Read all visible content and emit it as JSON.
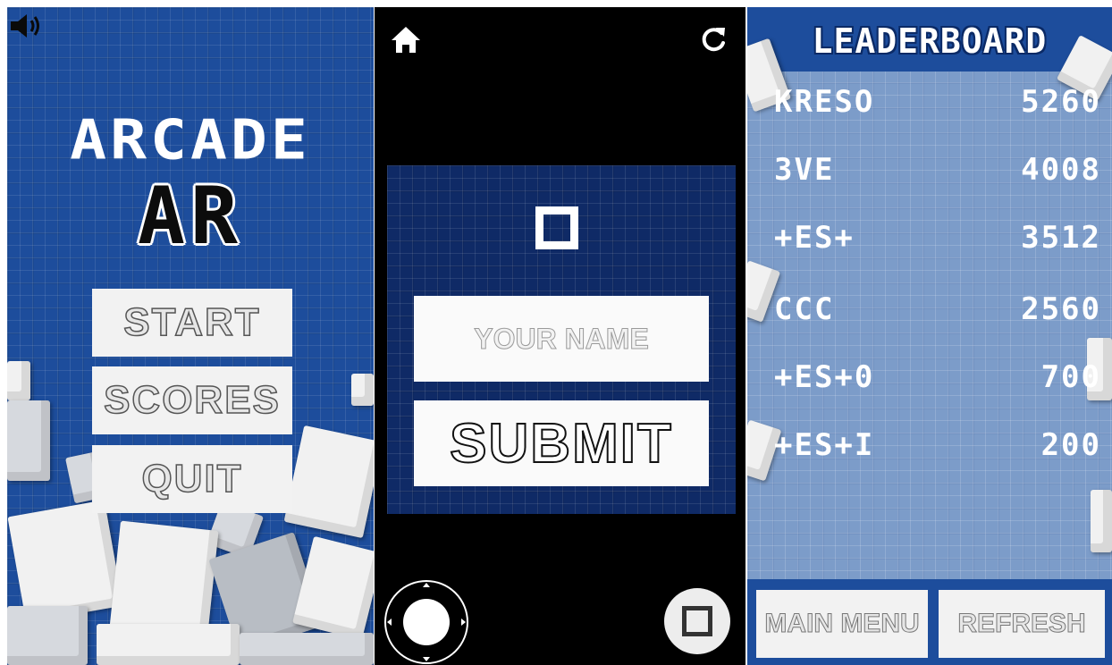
{
  "menu_screen": {
    "title_line1": "ARCADE",
    "title_line2": "AR",
    "buttons": [
      {
        "label": "START"
      },
      {
        "label": "SCORES"
      },
      {
        "label": "QUIT"
      }
    ],
    "sound_icon": "speaker-icon"
  },
  "submit_screen": {
    "home_icon": "home-icon",
    "refresh_icon": "refresh-icon",
    "name_placeholder": "YOUR NAME",
    "name_value": "",
    "submit_label": "SUBMIT",
    "joystick_icon": "joystick-icon",
    "action_icon": "square-action-icon"
  },
  "leaderboard_screen": {
    "title": "LEADERBOARD",
    "entries": [
      {
        "name": "KRESO",
        "score": "5260"
      },
      {
        "name": "3VE",
        "score": "4008"
      },
      {
        "name": "+ES+",
        "score": "3512"
      },
      {
        "name": "CCC",
        "score": "2560"
      },
      {
        "name": "+ES+0",
        "score": "700"
      },
      {
        "name": "+ES+I",
        "score": "200"
      }
    ],
    "main_menu_label": "MAIN MENU",
    "refresh_label": "REFRESH"
  },
  "colors": {
    "menu_background": "#1d4d9c",
    "leaderboard_background": "#7c9cc9",
    "form_background": "#0f2a66",
    "button_face": "#f2f2f2"
  }
}
